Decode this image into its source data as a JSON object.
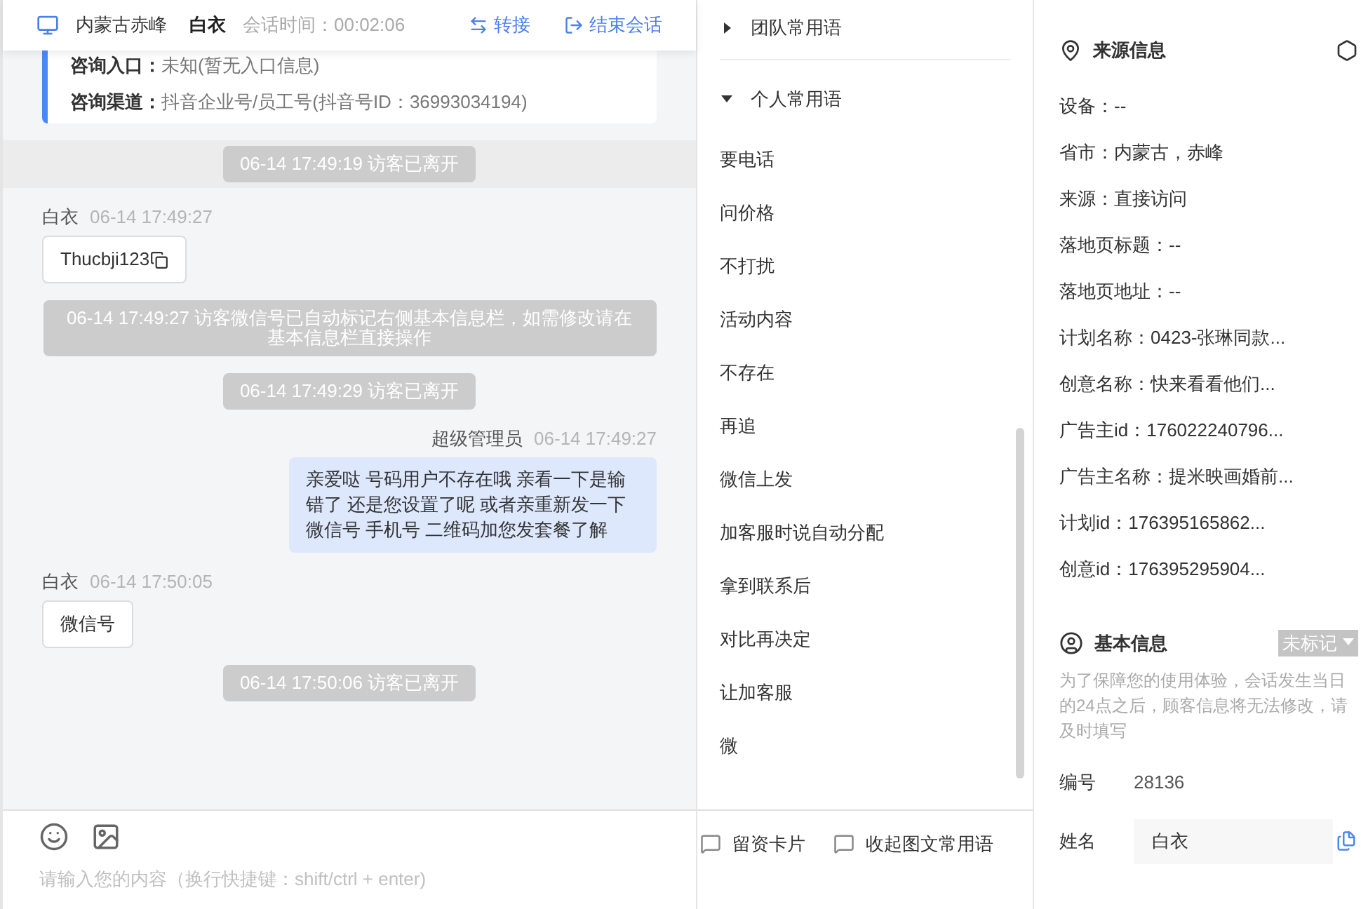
{
  "header": {
    "location": "内蒙古赤峰",
    "visitor": "白衣",
    "session_label": "会话时间：",
    "session_time": "00:02:06",
    "actions": [
      {
        "kind": "transfer",
        "label": "转接"
      },
      {
        "kind": "end",
        "label": "结束会话"
      }
    ]
  },
  "consult_info": [
    {
      "label": "咨询入口：",
      "value": "未知(暂无入口信息)"
    },
    {
      "label": "咨询渠道：",
      "value": "抖音企业号/员工号(抖音号ID：36993034194)"
    }
  ],
  "messages": [
    {
      "kind": "system",
      "text": "06-14 17:49:19 访客已离开",
      "highlighted": true
    },
    {
      "kind": "visitor",
      "name": "白衣",
      "time": "06-14 17:49:27",
      "text": "Thucbji123",
      "copyable": true
    },
    {
      "kind": "system",
      "text": "06-14 17:49:27 访客微信号已自动标记右侧基本信息栏，如需修改请在基本信息栏直接操作",
      "highlighted": false
    },
    {
      "kind": "system",
      "text": "06-14 17:49:29 访客已离开",
      "highlighted": false
    },
    {
      "kind": "agent",
      "name": "超级管理员",
      "time": "06-14 17:49:27",
      "text": "亲爱哒 号码用户不存在哦 亲看一下是输错了 还是您设置了呢 或者亲重新发一下微信号 手机号 二维码加您发套餐了解"
    },
    {
      "kind": "visitor",
      "name": "白衣",
      "time": "06-14 17:50:05",
      "text": "微信号",
      "copyable": false
    },
    {
      "kind": "system",
      "text": "06-14 17:50:06 访客已离开",
      "highlighted": false
    }
  ],
  "input": {
    "placeholder": "请输入您的内容（换行快捷键：shift/ctrl + enter)"
  },
  "phrase_groups": [
    {
      "label": "团队常用语",
      "expanded": false
    },
    {
      "label": "个人常用语",
      "expanded": true,
      "items": [
        "要电话",
        "问价格",
        "不打扰",
        "活动内容",
        "不存在",
        "再追",
        "微信上发",
        "加客服时说自动分配",
        "拿到联系后",
        "对比再决定",
        "让加客服",
        "微"
      ]
    }
  ],
  "phrase_footer": [
    "留资卡片",
    "收起图文常用语"
  ],
  "source_info": {
    "title": "来源信息",
    "fields": [
      "设备：--",
      "省市：内蒙古，赤峰",
      "来源：直接访问",
      "落地页标题：--",
      "落地页地址：--",
      "计划名称：0423-张琳同款...",
      "创意名称：快来看看他们...",
      "广告主id：176022240796...",
      "广告主名称：提米映画婚前...",
      "计划id：176395165862...",
      "创意id：176395295904..."
    ]
  },
  "basic_info": {
    "title": "基本信息",
    "tag": "未标记",
    "notice": "为了保障您的使用体验，会话发生当日的24点之后，顾客信息将无法修改，请及时填写",
    "fields": [
      {
        "kind": "text",
        "label": "编号",
        "value": "28136"
      },
      {
        "kind": "input",
        "label": "姓名",
        "value": "白衣"
      }
    ]
  }
}
